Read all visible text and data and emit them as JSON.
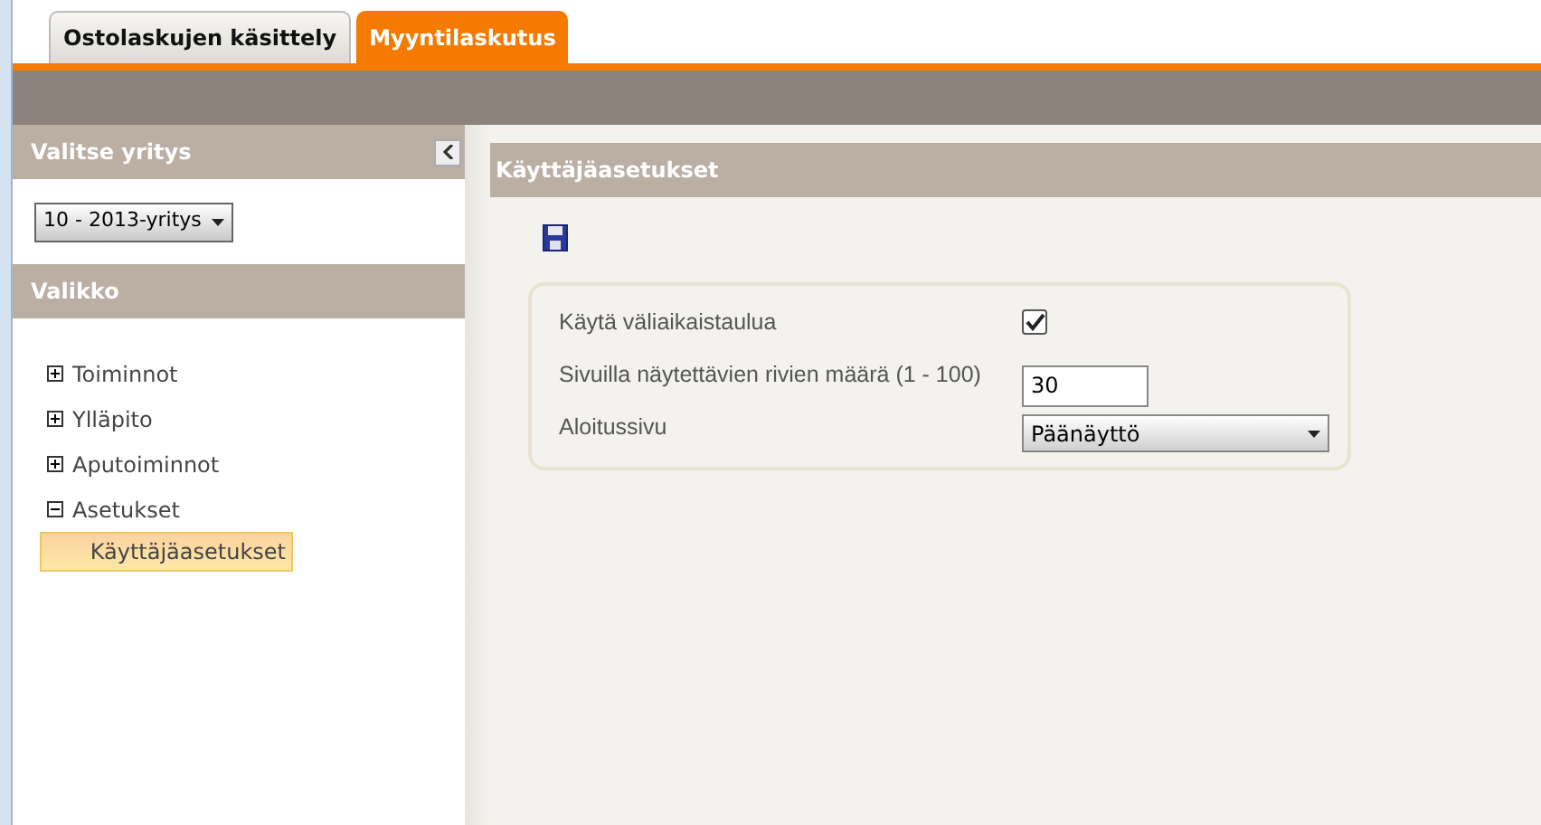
{
  "tabs": [
    {
      "label": "Ostolaskujen käsittely",
      "selected": false
    },
    {
      "label": "Myyntilaskutus",
      "selected": true
    }
  ],
  "sidebar": {
    "company_title": "Valitse yritys",
    "company_select": {
      "value": "10 - 2013-yritys"
    },
    "menu_title": "Valikko",
    "menu": [
      {
        "label": "Toiminnot",
        "expanded": false
      },
      {
        "label": "Ylläpito",
        "expanded": false
      },
      {
        "label": "Aputoiminnot",
        "expanded": false
      },
      {
        "label": "Asetukset",
        "expanded": true,
        "children": [
          {
            "label": "Käyttäjäasetukset",
            "selected": true
          }
        ]
      }
    ]
  },
  "content": {
    "title": "Käyttäjäasetukset",
    "fields": [
      {
        "kind": "checkbox",
        "label": "Käytä väliaikaistaulua",
        "checked": true
      },
      {
        "kind": "text",
        "label": "Sivuilla näytettävien rivien määrä (1 - 100)",
        "value": "30"
      },
      {
        "kind": "select",
        "label": "Aloitussivu",
        "value": "Päänäyttö"
      }
    ]
  }
}
